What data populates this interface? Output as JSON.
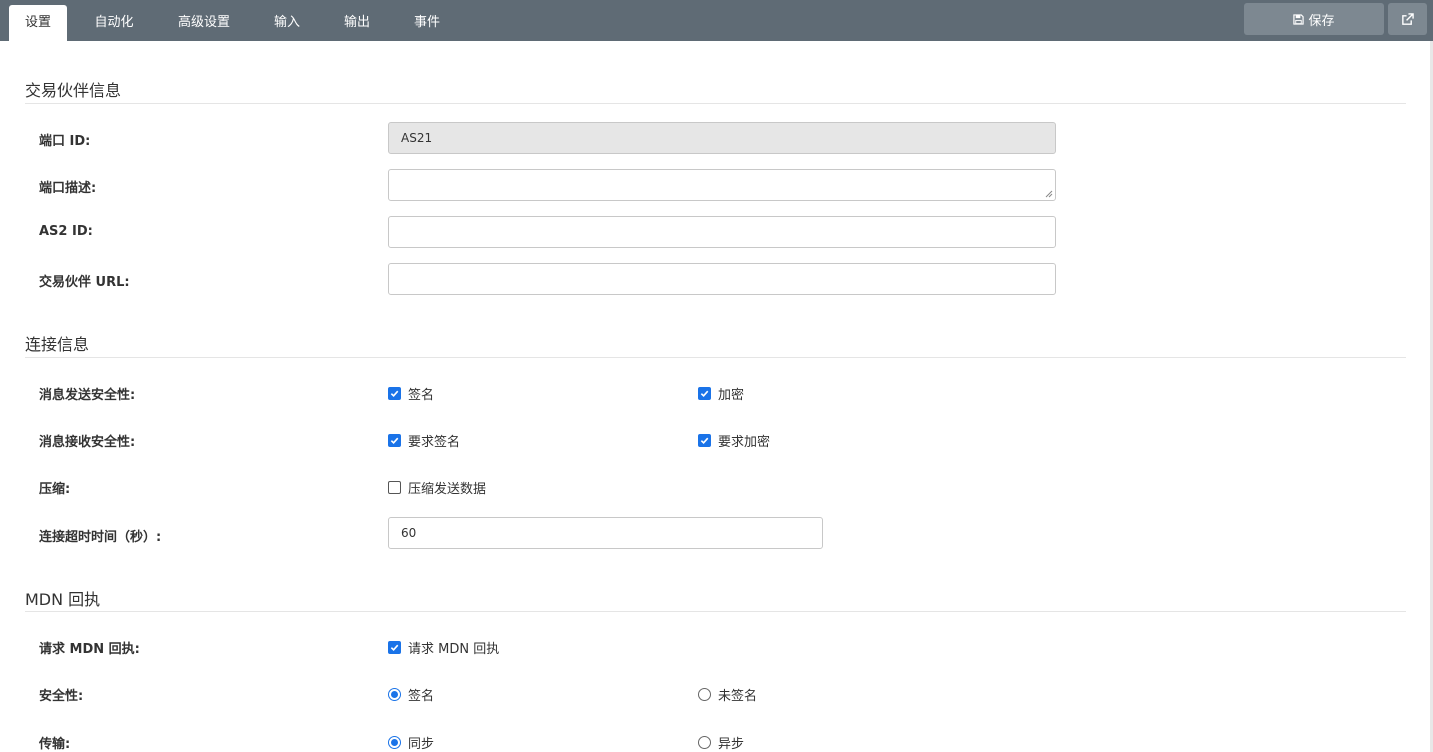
{
  "tabs": [
    "设置",
    "自动化",
    "高级设置",
    "输入",
    "输出",
    "事件"
  ],
  "toolbar": {
    "save_label": "保存",
    "save_icon": "floppy-disk-icon",
    "external_icon": "external-link-icon"
  },
  "sections": {
    "partner": {
      "title": "交易伙伴信息",
      "port_id_label": "端口 ID:",
      "port_id_value": "AS21",
      "port_desc_label": "端口描述:",
      "port_desc_value": "",
      "as2_id_label": "AS2 ID:",
      "as2_id_value": "",
      "partner_url_label": "交易伙伴 URL:",
      "partner_url_value": ""
    },
    "connection": {
      "title": "连接信息",
      "send_security_label": "消息发送安全性:",
      "send_sign": {
        "label": "签名",
        "checked": true
      },
      "send_encrypt": {
        "label": "加密",
        "checked": true
      },
      "receive_security_label": "消息接收安全性:",
      "receive_sign": {
        "label": "要求签名",
        "checked": true
      },
      "receive_encrypt": {
        "label": "要求加密",
        "checked": true
      },
      "compression_label": "压缩:",
      "compress_send": {
        "label": "压缩发送数据",
        "checked": false
      },
      "timeout_label": "连接超时时间（秒）:",
      "timeout_value": "60"
    },
    "mdn": {
      "title": "MDN 回执",
      "request_label": "请求 MDN 回执:",
      "request_mdn": {
        "label": "请求 MDN 回执",
        "checked": true
      },
      "security_label": "安全性:",
      "security_signed": {
        "label": "签名",
        "selected": true
      },
      "security_unsigned": {
        "label": "未签名",
        "selected": false
      },
      "transport_label": "传输:",
      "transport_sync": {
        "label": "同步",
        "selected": true
      },
      "transport_async": {
        "label": "异步",
        "selected": false
      }
    }
  },
  "colors": {
    "topbar": "#5f6b75",
    "button": "#7d8891",
    "accent": "#1a73e8"
  }
}
